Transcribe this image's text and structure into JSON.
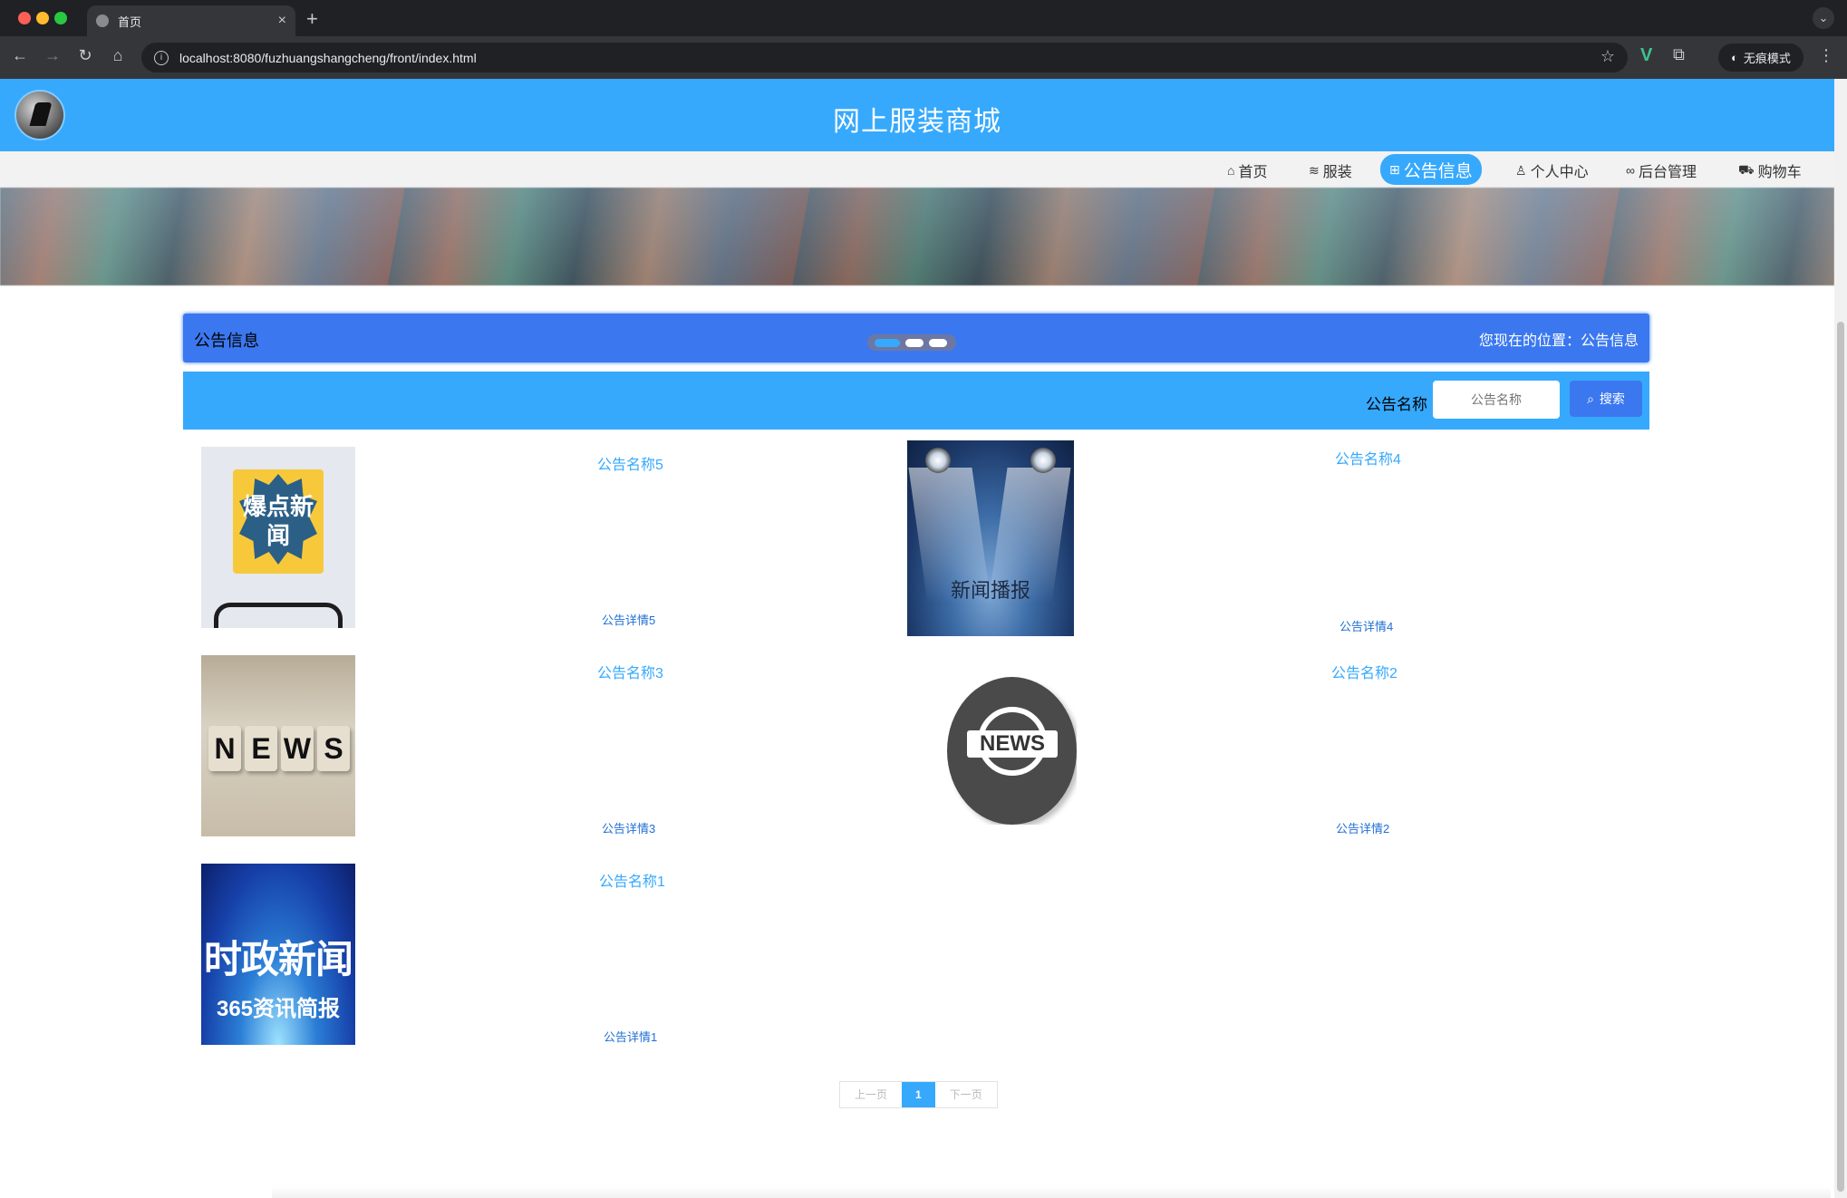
{
  "browser": {
    "tab_title": "首页",
    "url": "localhost:8080/fuzhuangshangcheng/front/index.html",
    "incognito_label": "无痕模式"
  },
  "site": {
    "title": "网上服装商城"
  },
  "nav": {
    "items": [
      {
        "label": "首页",
        "icon": "home-icon"
      },
      {
        "label": "服装",
        "icon": "layers-icon"
      },
      {
        "label": "公告信息",
        "icon": "grid-icon",
        "active": true
      },
      {
        "label": "个人中心",
        "icon": "user-icon"
      },
      {
        "label": "后台管理",
        "icon": "link-icon"
      },
      {
        "label": "购物车",
        "icon": "cart-icon"
      }
    ]
  },
  "section": {
    "title": "公告信息",
    "breadcrumb": "您现在的位置：公告信息"
  },
  "search": {
    "label": "公告名称",
    "placeholder": "公告名称",
    "button": "搜索"
  },
  "news": [
    {
      "name": "公告名称5",
      "detail": "公告详情5",
      "image_text": "爆点新闻"
    },
    {
      "name": "公告名称4",
      "detail": "公告详情4",
      "image_text": "新闻播报"
    },
    {
      "name": "公告名称3",
      "detail": "公告详情3",
      "image_text": "NEWS"
    },
    {
      "name": "公告名称2",
      "detail": "公告详情2",
      "image_text": "NEWS"
    },
    {
      "name": "公告名称1",
      "detail": "公告详情1",
      "image_text": "时政新闻",
      "image_subtext": "365资讯简报"
    }
  ],
  "pagination": {
    "prev": "上一页",
    "current": "1",
    "next": "下一页"
  },
  "colors": {
    "brand": "#36a9fd",
    "section_bar": "#3b78f0"
  }
}
